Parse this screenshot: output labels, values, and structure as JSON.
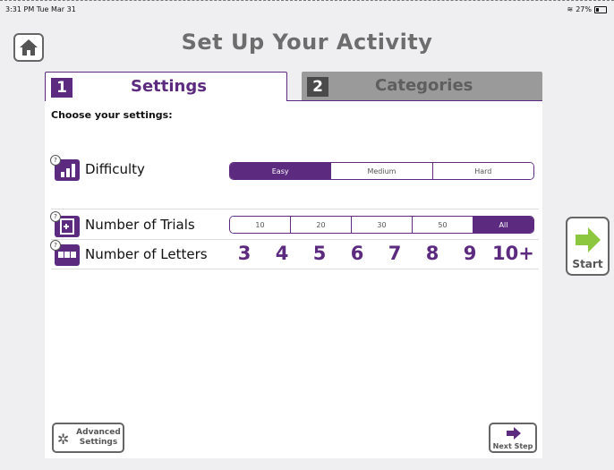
{
  "status_bar": {
    "time": "3:31 PM  Tue Mar 31",
    "battery": "27%"
  },
  "header": {
    "title": "Set Up Your Activity"
  },
  "tabs": [
    {
      "number": "1",
      "label": "Settings",
      "active": true
    },
    {
      "number": "2",
      "label": "Categories",
      "active": false
    }
  ],
  "settings": {
    "prompt": "Choose your settings:",
    "difficulty": {
      "label": "Difficulty",
      "options": [
        "Easy",
        "Medium",
        "Hard"
      ],
      "selected": "Easy"
    },
    "trials": {
      "label": "Number of Trials",
      "options": [
        "10",
        "20",
        "30",
        "50",
        "All"
      ],
      "selected": "All"
    },
    "letters": {
      "label": "Number of Letters",
      "options": [
        "3",
        "4",
        "5",
        "6",
        "7",
        "8",
        "9",
        "10+"
      ]
    }
  },
  "buttons": {
    "advanced_line1": "Advanced",
    "advanced_line2": "Settings",
    "next_step": "Next Step",
    "start": "Start"
  },
  "colors": {
    "accent": "#5c2b80",
    "start_green": "#8dc63f",
    "tab_inactive": "#9a9a9a"
  },
  "icons": [
    "home-icon",
    "difficulty-icon",
    "trials-icon",
    "letters-icon",
    "help-icon",
    "gear-icon",
    "arrow-right-icon"
  ]
}
